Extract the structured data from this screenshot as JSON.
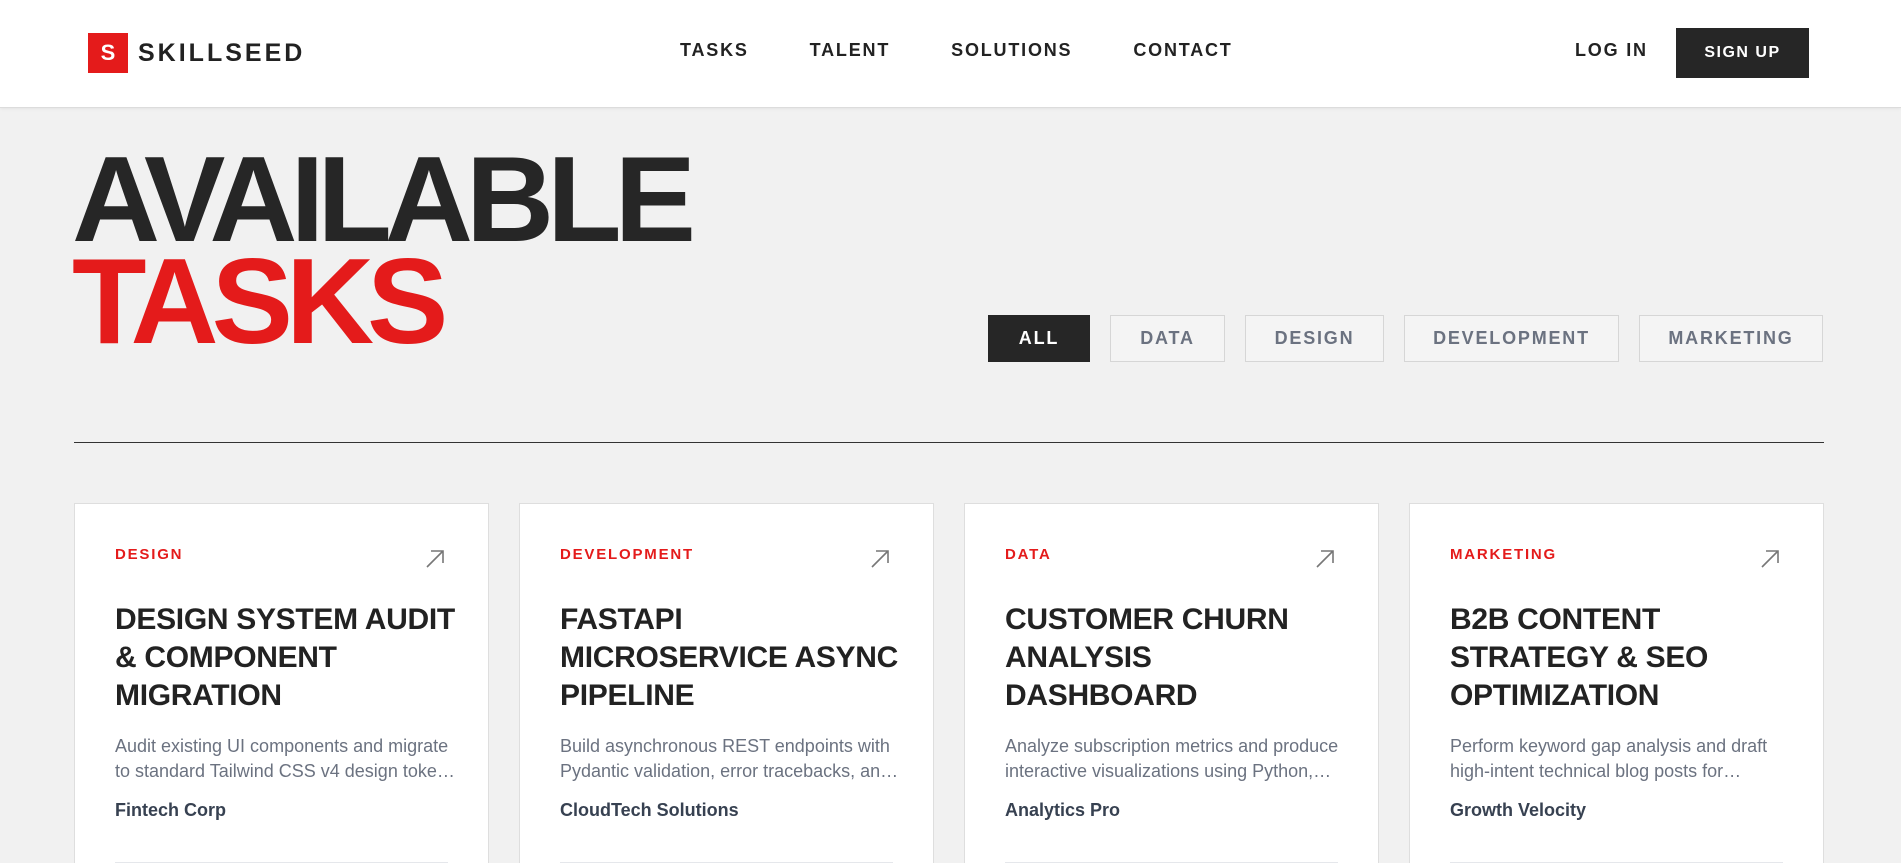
{
  "brand": {
    "mark": "S",
    "name": "SKILLSEED",
    "accent": "#e41b1b",
    "dark": "#262626"
  },
  "nav": {
    "items": [
      "TASKS",
      "TALENT",
      "SOLUTIONS",
      "CONTACT"
    ]
  },
  "auth": {
    "login": "LOG IN",
    "signup": "SIGN UP"
  },
  "hero": {
    "line1": "AVAILABLE",
    "line2": "TASKS"
  },
  "filters": [
    {
      "label": "ALL",
      "active": true
    },
    {
      "label": "DATA",
      "active": false
    },
    {
      "label": "DESIGN",
      "active": false
    },
    {
      "label": "DEVELOPMENT",
      "active": false
    },
    {
      "label": "MARKETING",
      "active": false
    }
  ],
  "cards": [
    {
      "category": "DESIGN",
      "title": "DESIGN SYSTEM AUDIT & COMPONENT MIGRATION",
      "description": "Audit existing UI components and migrate to standard Tailwind CSS v4 design toke…",
      "company": "Fintech Corp",
      "icon": "arrow-up-right-icon"
    },
    {
      "category": "DEVELOPMENT",
      "title": "FASTAPI MICROSERVICE ASYNC PIPELINE",
      "description": "Build asynchronous REST endpoints with Pydantic validation, error tracebacks, an…",
      "company": "CloudTech Solutions",
      "icon": "arrow-up-right-icon"
    },
    {
      "category": "DATA",
      "title": "CUSTOMER CHURN ANALYSIS DASHBOARD",
      "description": "Analyze subscription metrics and produce interactive visualizations using Python,…",
      "company": "Analytics Pro",
      "icon": "arrow-up-right-icon"
    },
    {
      "category": "MARKETING",
      "title": "B2B CONTENT STRATEGY & SEO OPTIMIZATION",
      "description": "Perform keyword gap analysis and draft high-intent technical blog posts for…",
      "company": "Growth Velocity",
      "icon": "arrow-up-right-icon"
    }
  ]
}
